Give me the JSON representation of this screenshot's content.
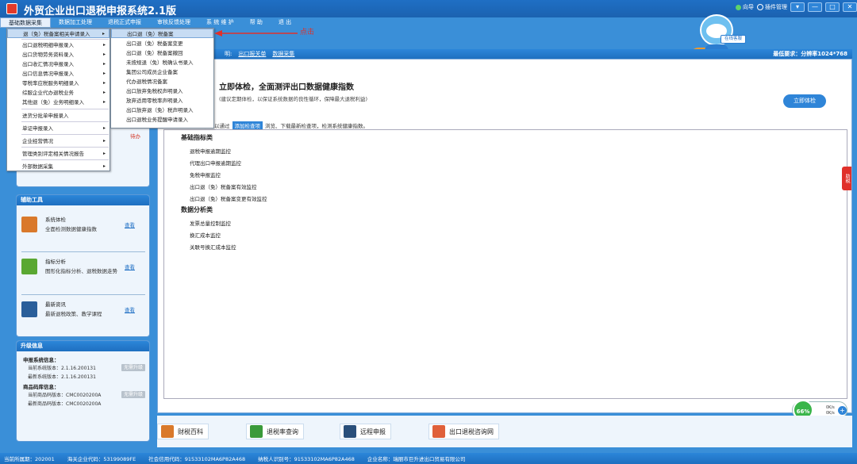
{
  "window": {
    "title": "外贸企业出口退税申报系统2.1版",
    "links": {
      "guide": "向导",
      "plugin": "插件管理"
    },
    "buttons": {
      "dropdown": "▾",
      "minimize": "—",
      "maximize": "□",
      "close": "✕"
    }
  },
  "menubar": [
    "基础数据采集",
    "数据加工处理",
    "退税正式申报",
    "审核反馈处理",
    "系 统 维 护",
    "帮 助",
    "退 出"
  ],
  "mascot": {
    "sign": "在线客服"
  },
  "notice": {
    "prefix_fragment": "明:",
    "links": [
      "出口报关单",
      "数据采集"
    ],
    "resolution": "最低要求：分辨率1024*768"
  },
  "health": {
    "title": "立即体检，全面测评出口数据健康指数",
    "subtitle": "(建议定期体检，以保证系统数据的良性循环，保障最大退税利益)",
    "button": "立即体检",
    "hint_prefix": "，可以通过",
    "hint_tag": "添加检查项",
    "hint_suffix": "浏览、下载最新检查项，检测系统健康指数。"
  },
  "check_categories": [
    {
      "title": "基础指标类",
      "items": [
        "退税申报逾期监控",
        "代理出口申报逾期监控",
        "免税申报监控",
        "出口退（免）税备案有效监控",
        "出口退（免）税备案变更有效监控"
      ]
    },
    {
      "title": "数据分析类",
      "items": [
        "发票总量控制监控",
        "换汇成本监控",
        "关联号换汇成本监控"
      ]
    }
  ],
  "dropdown_main": [
    {
      "label": "退（免）税备案相关申请录入",
      "arrow": "▸"
    },
    {
      "label": "出口退税明细申报录入",
      "arrow": "▸"
    },
    {
      "label": "出口货物劳务资料录入",
      "arrow": "▸"
    },
    {
      "label": "出口收汇情况申报录入",
      "arrow": "▸"
    },
    {
      "label": "出口信息情况申报录入",
      "arrow": "▸"
    },
    {
      "label": "零税率应税服务明细录入",
      "arrow": "▸"
    },
    {
      "label": "综服企业代办退税业务",
      "arrow": "▸"
    },
    {
      "label": "其他退（免）业务明细录入",
      "arrow": "▸"
    },
    {
      "label": "进货分批单申报录入",
      "arrow": ""
    },
    {
      "label": "单证申报录入",
      "arrow": "▸"
    },
    {
      "label": "企业经营情况",
      "arrow": "▸"
    },
    {
      "label": "管理类别评定相关情况报告",
      "arrow": "▸"
    },
    {
      "label": "外部数据采集",
      "arrow": "▸"
    }
  ],
  "dropdown_sub": [
    "出口退（免）税备案",
    "出口退（免）税备案变更",
    "出口退（免）税备案撤回",
    "未按规退（免）税确认书录入",
    "集团公司成员企业备案",
    "代办退税情况备案",
    "出口放弃免税权声明录入",
    "放弃适用零税率声明录入",
    "出口放弃退（免）税声明录入",
    "出口退税业务提醒申请录入"
  ],
  "annotation": "点击",
  "sidebar": {
    "red_text": "待办",
    "tools_title": "辅助工具",
    "tools": [
      {
        "name": "系统体检",
        "desc": "全面检测数据健康指数",
        "link": "查看",
        "icon": "toolbox-icon",
        "color": "#d9792b"
      },
      {
        "name": "指标分析",
        "desc": "图形化指标分析、退税数据走势",
        "link": "查看",
        "icon": "chart-icon",
        "color": "#5aa832"
      },
      {
        "name": "最新资讯",
        "desc": "最新退税政策、教学课程",
        "link": "查看",
        "icon": "news-icon",
        "color": "#2a5f9a"
      }
    ],
    "upgrade_title": "升级信息",
    "upgrade": {
      "sys_label": "申报系统信息：",
      "sys_current": "当前系统版本：2.1.16.200131",
      "sys_latest": "最新系统版本：2.1.16.200131",
      "goods_label": "商品码库信息：",
      "goods_current": "当前商品码版本：CMC0020200A",
      "goods_latest": "最新商品码版本：CMC0020200A",
      "button": "无需升级"
    }
  },
  "side_tab": "助税",
  "status_widget": {
    "percent": "66%",
    "speed_up": "0K/s",
    "speed_down": "0K/s",
    "plus": "+"
  },
  "quick_links": [
    {
      "label": "财税百科",
      "icon": "book-icon",
      "color": "#d9792b"
    },
    {
      "label": "退税率查询",
      "icon": "money-search-icon",
      "color": "#3a9a3a"
    },
    {
      "label": "远程申报",
      "icon": "monitor-icon",
      "color": "#2a4f7a"
    },
    {
      "label": "出口退税咨询网",
      "icon": "globe-icon",
      "color": "#e0603a"
    }
  ],
  "statusbar": [
    "当前所属期：202001",
    "海关企业代码：53199089FE",
    "社会信用代码：91533102MA6P82A468",
    "纳税人识别号：91533102MA6P82A468",
    "企业名称：瑞丽市巨升进出口贸易有限公司"
  ]
}
